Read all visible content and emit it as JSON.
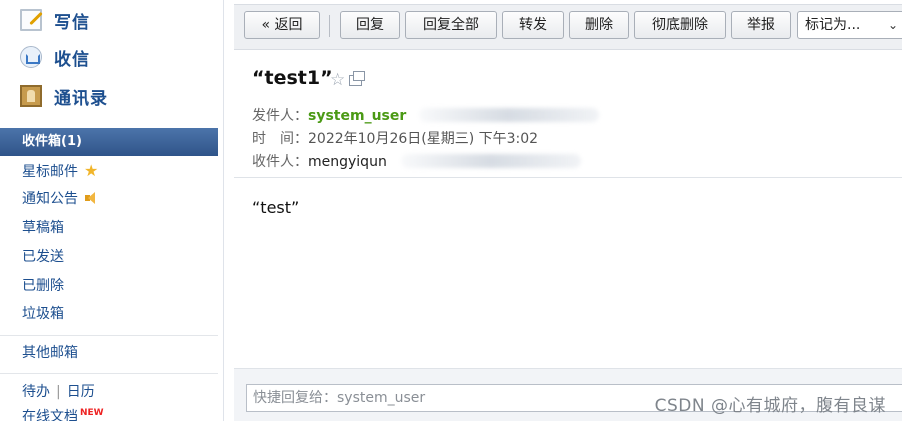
{
  "sidebar": {
    "compose": "写信",
    "receive": "收信",
    "contacts": "通讯录",
    "inbox": "收件箱(1)",
    "folders": [
      "星标邮件",
      "通知公告",
      "草稿箱",
      "已发送",
      "已删除",
      "垃圾箱"
    ],
    "other": "其他邮箱",
    "todo": "待办",
    "separator": "|",
    "calendar": "日历",
    "online_docs": "在线文档",
    "new_badge": "NEW"
  },
  "toolbar": {
    "back": "« 返回",
    "reply": "回复",
    "reply_all": "回复全部",
    "forward": "转发",
    "delete": "删除",
    "delete_permanent": "彻底删除",
    "report": "举报",
    "mark_as": "标记为...",
    "chevron": "⌄"
  },
  "mail": {
    "subject": "“test1”",
    "sender_label": "发件人：",
    "sender": "system_user",
    "time_label": "时　间：",
    "time": "2022年10月26日(星期三) 下午3:02",
    "recipient_label": "收件人：",
    "recipient": "mengyiqun",
    "body": "“test”"
  },
  "reply": {
    "placeholder": "快捷回复给：system_user"
  },
  "watermark": "CSDN @心有城府，腹有良谋",
  "colors": {
    "sidebar_link": "#1d4f8f",
    "active_folder": "#2f5489",
    "sender": "#4b9a15"
  }
}
